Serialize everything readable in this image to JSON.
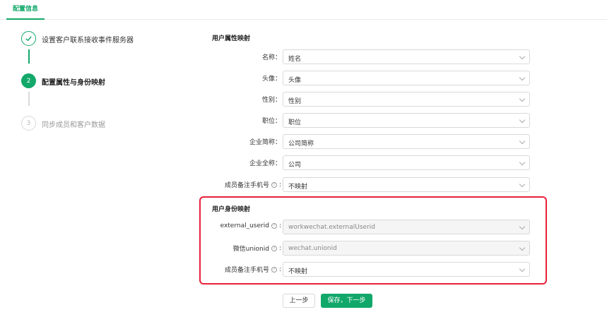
{
  "tabs": [
    {
      "label": "配置信息"
    }
  ],
  "steps": [
    {
      "number": "",
      "title": "设置客户联系接收事件服务器",
      "state": "done"
    },
    {
      "number": "2",
      "title": "配置属性与身份映射",
      "state": "active"
    },
    {
      "number": "3",
      "title": "同步成员和客户数据",
      "state": "todo"
    }
  ],
  "attribute_mapping": {
    "title": "用户属性映射",
    "rows": [
      {
        "label": "名称：",
        "value": "姓名",
        "help": false
      },
      {
        "label": "头像：",
        "value": "头像",
        "help": false
      },
      {
        "label": "性别：",
        "value": "性别",
        "help": false
      },
      {
        "label": "职位：",
        "value": "职位",
        "help": false
      },
      {
        "label": "企业简称：",
        "value": "公司简称",
        "help": false
      },
      {
        "label": "企业全称：",
        "value": "公司",
        "help": false
      },
      {
        "label": "成员备注手机号",
        "value": "不映射",
        "help": true
      }
    ]
  },
  "identity_mapping": {
    "title": "用户身份映射",
    "rows": [
      {
        "label": "external_userid",
        "value": "workwechat.externalUserid",
        "help": true,
        "disabled": true
      },
      {
        "label": "微信unionid",
        "value": "wechat.unionid",
        "help": true,
        "disabled": true
      },
      {
        "label": "成员备注手机号",
        "value": "不映射",
        "help": true,
        "disabled": false
      }
    ]
  },
  "buttons": {
    "prev": "上一步",
    "next": "保存，下一步"
  },
  "colors": {
    "accent": "#12a86a",
    "highlight": "#e8213a"
  },
  "icons": {
    "done_step": "check-icon",
    "select_arrow": "chevron-down-icon",
    "help": "help-circle-icon"
  }
}
